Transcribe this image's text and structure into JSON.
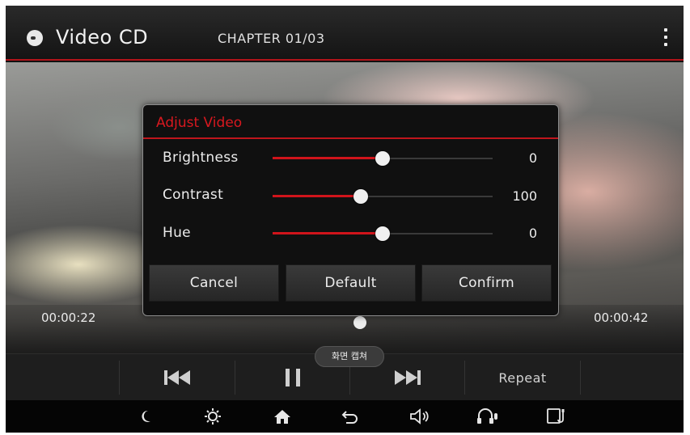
{
  "header": {
    "title": "Video CD",
    "chapter": "CHAPTER 01/03"
  },
  "player": {
    "elapsed": "00:00:22",
    "total": "00:00:42",
    "capture_tooltip": "화면 캡쳐",
    "repeat_label": "Repeat"
  },
  "dialog": {
    "title": "Adjust Video",
    "rows": [
      {
        "label": "Brightness",
        "value": "0",
        "level": 0.5
      },
      {
        "label": "Contrast",
        "value": "100",
        "level": 0.4
      },
      {
        "label": "Hue",
        "value": "0",
        "level": 0.5
      }
    ],
    "buttons": {
      "cancel": "Cancel",
      "default": "Default",
      "confirm": "Confirm"
    }
  },
  "icons": {
    "header": [
      "disc-icon",
      "more-menu-icon"
    ],
    "controls": [
      "previous-track-icon",
      "pause-icon",
      "next-track-icon"
    ],
    "system": [
      "night-mode-icon",
      "brightness-icon",
      "home-icon",
      "back-icon",
      "volume-icon",
      "voice-icon",
      "phone-projection-icon"
    ]
  },
  "colors": {
    "accent": "#d0141b",
    "background": "#111111"
  }
}
